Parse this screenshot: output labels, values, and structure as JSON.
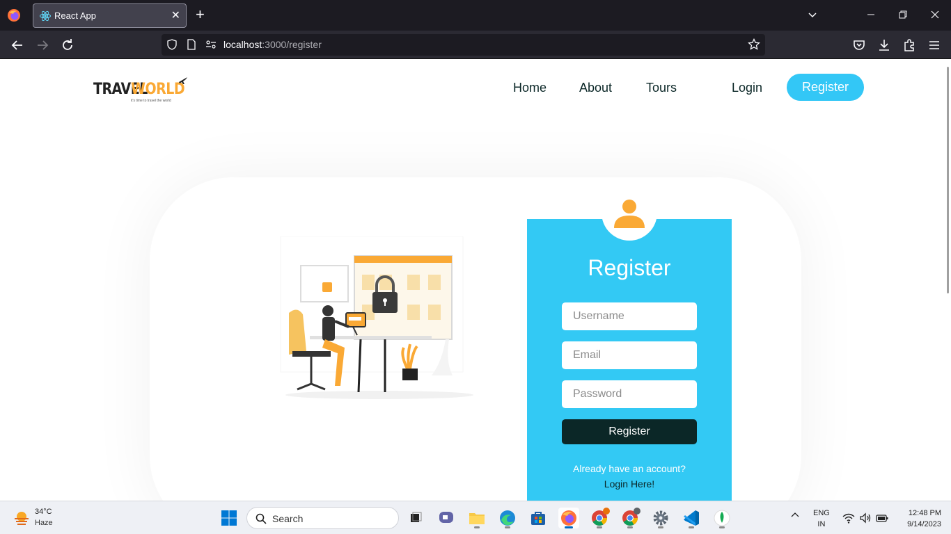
{
  "browser": {
    "tab_title": "React App",
    "url_host": "localhost",
    "url_path": ":3000/register"
  },
  "site": {
    "logo_part1": "TRAVEL",
    "logo_part2": "WORLD",
    "logo_tagline": "it's time to travel the world",
    "nav": [
      "Home",
      "About",
      "Tours"
    ],
    "login_label": "Login",
    "register_label": "Register"
  },
  "register_form": {
    "title": "Register",
    "username_placeholder": "Username",
    "email_placeholder": "Email",
    "password_placeholder": "Password",
    "submit_label": "Register",
    "already_text": "Already have an account?",
    "login_link": "Login Here!"
  },
  "colors": {
    "accent": "#33c7f6",
    "brand_orange": "#faa935",
    "heading": "#0b2727"
  },
  "taskbar": {
    "weather_temp": "34°C",
    "weather_desc": "Haze",
    "search_label": "Search",
    "lang_line1": "ENG",
    "lang_line2": "IN",
    "time": "12:48 PM",
    "date": "9/14/2023"
  }
}
